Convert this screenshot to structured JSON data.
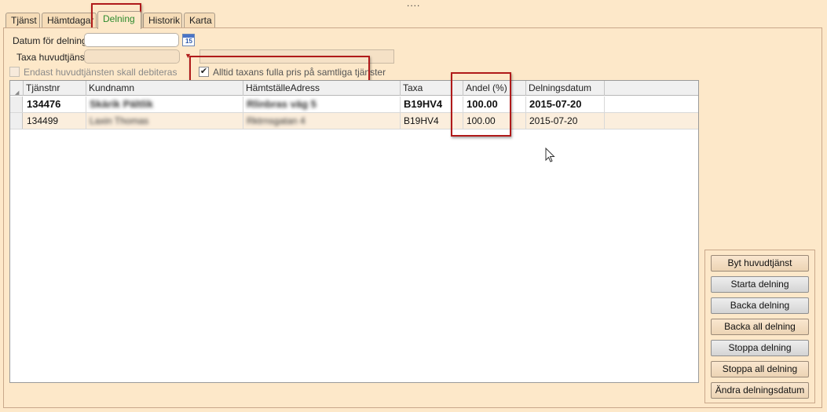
{
  "tabs": [
    {
      "label": "Tjänst"
    },
    {
      "label": "Hämtdagar"
    },
    {
      "label": "Delning"
    },
    {
      "label": "Historik"
    },
    {
      "label": "Karta"
    }
  ],
  "form": {
    "datum_label": "Datum för delning",
    "datum_value": "",
    "calendar_day": "15",
    "taxa_label": "Taxa huvudtjänst",
    "taxa_value": "",
    "endast_label": "Endast huvudtjänsten skall debiteras",
    "alltid_label": "Alltid taxans fulla pris på samtliga tjänster",
    "alltid_checked": true
  },
  "grid": {
    "columns": [
      "Tjänstnr",
      "Kundnamn",
      "HämtställeAdress",
      "Taxa",
      "Andel (%)",
      "Delningsdatum"
    ],
    "rows": [
      {
        "tjanstnr": "134476",
        "kundnamn": "Skärik Pältlik",
        "adress": "Rlinbras väg 5",
        "taxa": "B19HV4",
        "andel": "100.00",
        "datum": "2015-07-20"
      },
      {
        "tjanstnr": "134499",
        "kundnamn": "Laxin Thomas",
        "adress": "Rktrnsgatan 4",
        "taxa": "B19HV4",
        "andel": "100.00",
        "datum": "2015-07-20"
      }
    ]
  },
  "buttons": [
    {
      "label": "Byt huvudtjänst"
    },
    {
      "label": "Starta delning"
    },
    {
      "label": "Backa delning"
    },
    {
      "label": "Backa all delning"
    },
    {
      "label": "Stoppa delning"
    },
    {
      "label": "Stoppa all delning"
    },
    {
      "label": "Ändra delningsdatum"
    }
  ],
  "colors": {
    "background": "#fde8c9",
    "active_tab_text": "#2e8b2e",
    "highlight": "#b01a1a"
  }
}
